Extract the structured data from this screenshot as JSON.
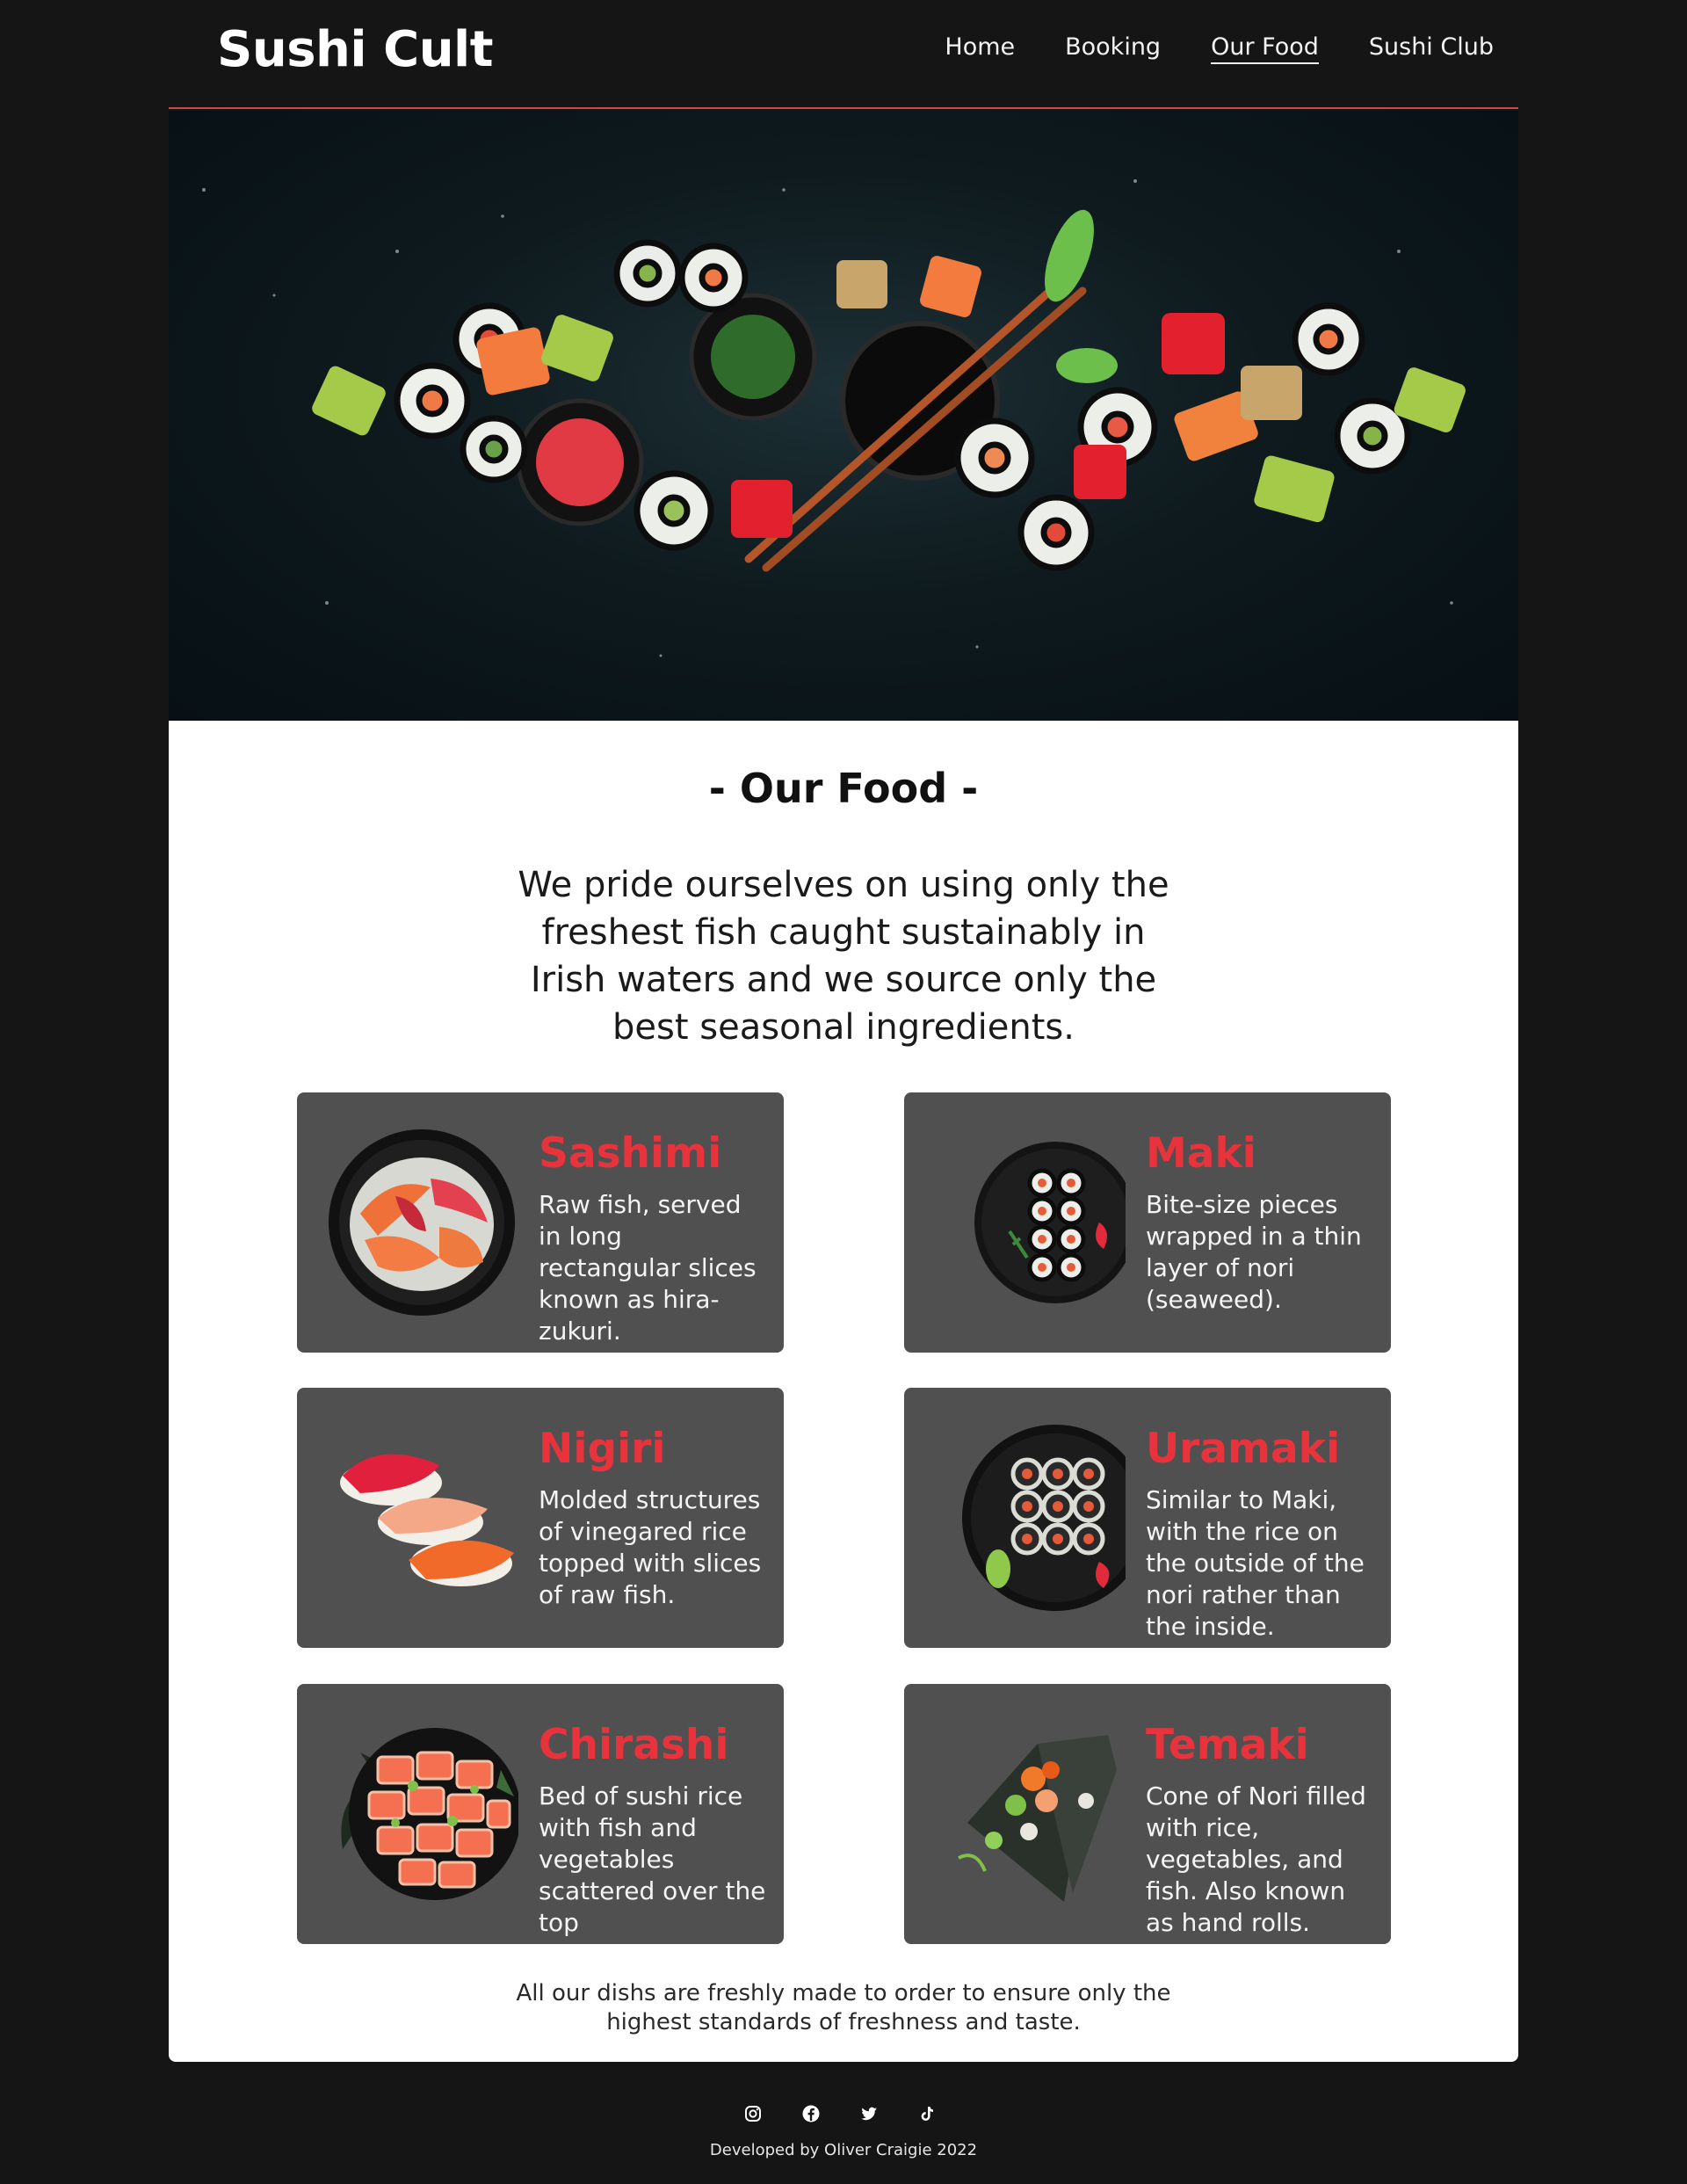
{
  "header": {
    "brand": "Sushi Cult",
    "nav": [
      "Home",
      "Booking",
      "Our Food",
      "Sushi Club"
    ],
    "active_index": 2
  },
  "hero": {
    "image": "sushi-platter-photo"
  },
  "main": {
    "title": "- Our Food -",
    "intro": "We pride ourselves on using only the freshest fish caught sustainably in Irish waters and we source only the best seasonal ingredients.",
    "dishes": [
      {
        "name": "Sashimi",
        "description": "Raw fish, served in long rectangular slices known as hira-zukuri.",
        "icon": "sashimi-plate"
      },
      {
        "name": "Maki",
        "description": "Bite-size pieces wrapped in a thin layer of nori (seaweed).",
        "icon": "maki-plate"
      },
      {
        "name": "Nigiri",
        "description": "Molded structures of vinegared rice topped with slices of raw fish.",
        "icon": "nigiri-trio"
      },
      {
        "name": "Uramaki",
        "description": "Similar to Maki, with the rice on the outside of the nori rather than the inside.",
        "icon": "uramaki-plate"
      },
      {
        "name": "Chirashi",
        "description": "Bed of sushi rice with fish and vegetables scattered over the top",
        "icon": "chirashi-plate"
      },
      {
        "name": "Temaki",
        "description": "Cone of Nori filled with rice, vegetables, and fish. Also known as hand rolls.",
        "icon": "temaki-cones"
      }
    ],
    "footnote": "All our dishs are freshly made to order to ensure only the highest standards of freshness and taste."
  },
  "footer": {
    "social": [
      "instagram-icon",
      "facebook-icon",
      "twitter-icon",
      "tiktok-icon"
    ],
    "credit": "Developed by Oliver Craigie 2022"
  },
  "colors": {
    "page_bg": "#151515",
    "accent": "#e8333c",
    "card_bg": "#505050",
    "divider": "#c94b4b"
  }
}
